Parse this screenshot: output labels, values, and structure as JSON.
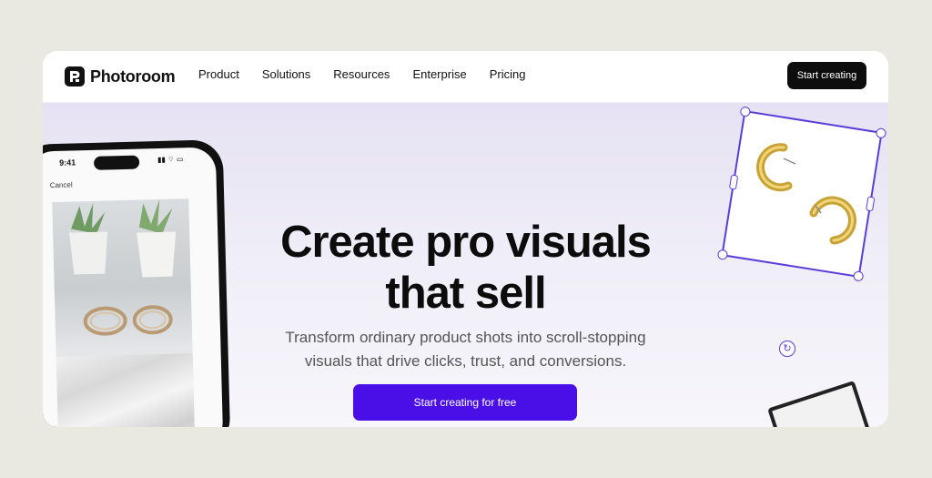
{
  "brand": {
    "name": "Photoroom"
  },
  "nav": {
    "items": [
      "Product",
      "Solutions",
      "Resources",
      "Enterprise",
      "Pricing"
    ],
    "cta": "Start creating"
  },
  "hero": {
    "headline": [
      "Create pro visuals",
      "that sell"
    ],
    "subheadline": [
      "Transform ordinary product shots into scroll-stopping",
      "visuals that drive clicks, trust, and conversions."
    ],
    "cta": "Start creating for free"
  },
  "phone": {
    "time": "9:41",
    "cancel": "Cancel"
  },
  "colors": {
    "accent": "#4a0fe6",
    "selection": "#5c3bd7",
    "dark": "#0d0d0d"
  },
  "icons": [
    "photoroom-logo-icon",
    "signal-icon",
    "wifi-icon",
    "battery-icon",
    "rotate-icon"
  ]
}
